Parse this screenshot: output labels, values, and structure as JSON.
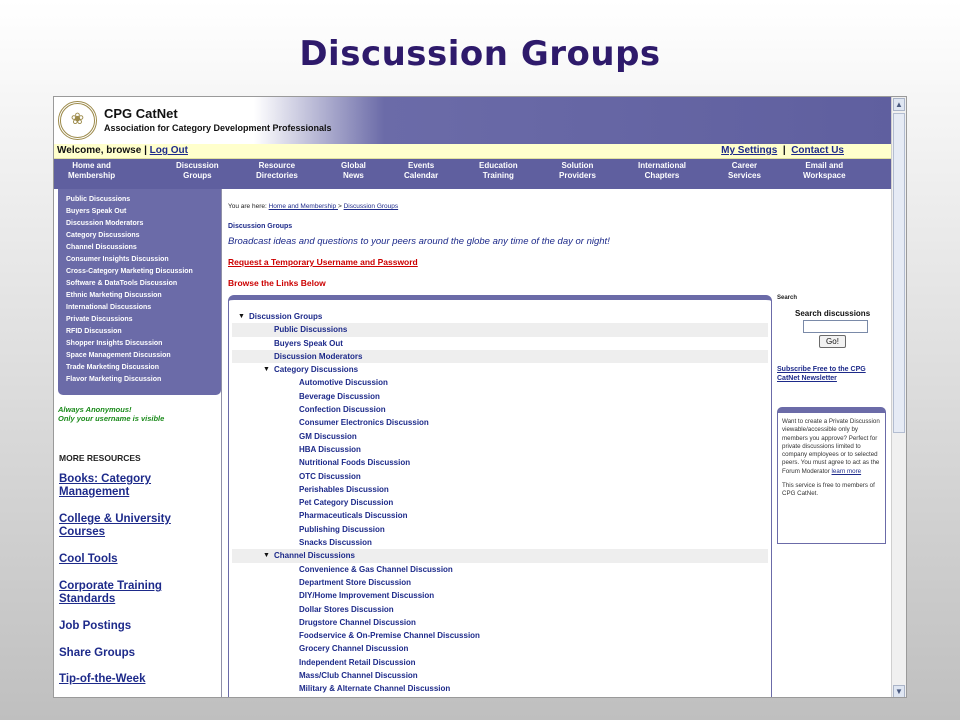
{
  "slide_title": "Discussion Groups",
  "colors": {
    "accent": "#6b6ba8",
    "nav": "#5f5f9f",
    "link": "#1d2a8a",
    "alert": "#cc0000",
    "green": "#1a8a1a",
    "userbar": "#ffffcc"
  },
  "header": {
    "brand": "CPG CatNet",
    "tagline": "Association for Category Development Professionals",
    "logo_icon": "seal-logo-icon"
  },
  "userbar": {
    "welcome": "Welcome, browse |",
    "logout": "Log Out",
    "my_settings": "My Settings",
    "separator": "|",
    "contact_us": "Contact Us"
  },
  "nav": {
    "items": [
      {
        "line1": "Home and",
        "line2": "Membership"
      },
      {
        "line1": "Discussion",
        "line2": "Groups"
      },
      {
        "line1": "Resource",
        "line2": "Directories"
      },
      {
        "line1": "Global",
        "line2": "News"
      },
      {
        "line1": "Events",
        "line2": "Calendar"
      },
      {
        "line1": "Education",
        "line2": "Training"
      },
      {
        "line1": "Solution",
        "line2": "Providers"
      },
      {
        "line1": "International",
        "line2": "Chapters"
      },
      {
        "line1": "Career",
        "line2": "Services"
      },
      {
        "line1": "Email and",
        "line2": "Workspace"
      }
    ]
  },
  "sidebar": {
    "items": [
      "Public Discussions",
      "Buyers Speak Out",
      "Discussion Moderators",
      "Category Discussions",
      "Channel Discussions",
      "Consumer Insights Discussion",
      "Cross-Category Marketing Discussion",
      "Software & DataTools Discussion",
      "Ethnic Marketing Discussion",
      "International Discussions",
      "Private Discussions",
      "RFID Discussion",
      "Shopper Insights Discussion",
      "Space Management Discussion",
      "Trade Marketing Discussion",
      "Flavor Marketing Discussion"
    ],
    "anon_line1": "Always Anonymous!",
    "anon_line2": "Only your username is visible",
    "more_title": "MORE RESOURCES",
    "resources": [
      "Books: Category Management",
      "College & University Courses",
      "Cool Tools",
      "Corporate Training Standards",
      "Job Postings",
      "Share Groups",
      "Tip-of-the-Week"
    ]
  },
  "main": {
    "breadcrumb_prefix": "You are here: ",
    "breadcrumb_home": "Home and Membership ",
    "breadcrumb_sep": "> ",
    "breadcrumb_current": "Discussion Groups",
    "section_label": "Discussion Groups",
    "intro": "Broadcast ideas and questions to your peers around the globe any time of the day or night!",
    "request_link": "Request a Temporary Username and Password",
    "browse_title": "Browse the Links Below"
  },
  "tree": [
    {
      "label": "Discussion Groups",
      "level": 0,
      "expanded": true,
      "shade": false
    },
    {
      "label": "Public Discussions",
      "level": 1,
      "expanded": false,
      "shade": true
    },
    {
      "label": "Buyers Speak Out",
      "level": 1,
      "expanded": false,
      "shade": false
    },
    {
      "label": "Discussion Moderators",
      "level": 1,
      "expanded": false,
      "shade": true
    },
    {
      "label": "Category Discussions",
      "level": 1,
      "expanded": true,
      "shade": false
    },
    {
      "label": "Automotive Discussion",
      "level": 2,
      "expanded": false,
      "shade": false
    },
    {
      "label": "Beverage Discussion",
      "level": 2,
      "expanded": false,
      "shade": false
    },
    {
      "label": "Confection Discussion",
      "level": 2,
      "expanded": false,
      "shade": false
    },
    {
      "label": "Consumer Electronics Discussion",
      "level": 2,
      "expanded": false,
      "shade": false
    },
    {
      "label": "GM Discussion",
      "level": 2,
      "expanded": false,
      "shade": false
    },
    {
      "label": "HBA Discussion",
      "level": 2,
      "expanded": false,
      "shade": false
    },
    {
      "label": "Nutritional Foods Discussion",
      "level": 2,
      "expanded": false,
      "shade": false
    },
    {
      "label": "OTC Discussion",
      "level": 2,
      "expanded": false,
      "shade": false
    },
    {
      "label": "Perishables Discussion",
      "level": 2,
      "expanded": false,
      "shade": false
    },
    {
      "label": "Pet Category Discussion",
      "level": 2,
      "expanded": false,
      "shade": false
    },
    {
      "label": "Pharmaceuticals Discussion",
      "level": 2,
      "expanded": false,
      "shade": false
    },
    {
      "label": "Publishing Discussion",
      "level": 2,
      "expanded": false,
      "shade": false
    },
    {
      "label": "Snacks Discussion",
      "level": 2,
      "expanded": false,
      "shade": false
    },
    {
      "label": "Channel Discussions",
      "level": 1,
      "expanded": true,
      "shade": true
    },
    {
      "label": "Convenience & Gas Channel Discussion",
      "level": 2,
      "expanded": false,
      "shade": false
    },
    {
      "label": "Department Store Discussion",
      "level": 2,
      "expanded": false,
      "shade": false
    },
    {
      "label": "DIY/Home Improvement Discussion",
      "level": 2,
      "expanded": false,
      "shade": false
    },
    {
      "label": "Dollar Stores Discussion",
      "level": 2,
      "expanded": false,
      "shade": false
    },
    {
      "label": "Drugstore Channel Discussion",
      "level": 2,
      "expanded": false,
      "shade": false
    },
    {
      "label": "Foodservice & On-Premise Channel Discussion",
      "level": 2,
      "expanded": false,
      "shade": false
    },
    {
      "label": "Grocery Channel Discussion",
      "level": 2,
      "expanded": false,
      "shade": false
    },
    {
      "label": "Independent Retail Discussion",
      "level": 2,
      "expanded": false,
      "shade": false
    },
    {
      "label": "Mass/Club Channel Discussion",
      "level": 2,
      "expanded": false,
      "shade": false
    },
    {
      "label": "Military & Alternate Channel Discussion",
      "level": 2,
      "expanded": false,
      "shade": false
    }
  ],
  "right": {
    "search_label": "Search",
    "search_title": "Search discussions",
    "search_value": "",
    "go_label": "Go!",
    "subscribe": "Subscribe Free to the CPG CatNet Newsletter",
    "info_text": "Want to create a Private Discussion viewable/accessible only by members you approve? Perfect for private discussions limited to company employees or to selected peers. You must agree to act as the Forum Moderator ",
    "info_link": "learn more",
    "info_text2": "This service is free to members of CPG CatNet."
  },
  "scrollbar": {
    "up_icon": "scroll-up-arrow-icon",
    "down_icon": "scroll-down-arrow-icon"
  }
}
